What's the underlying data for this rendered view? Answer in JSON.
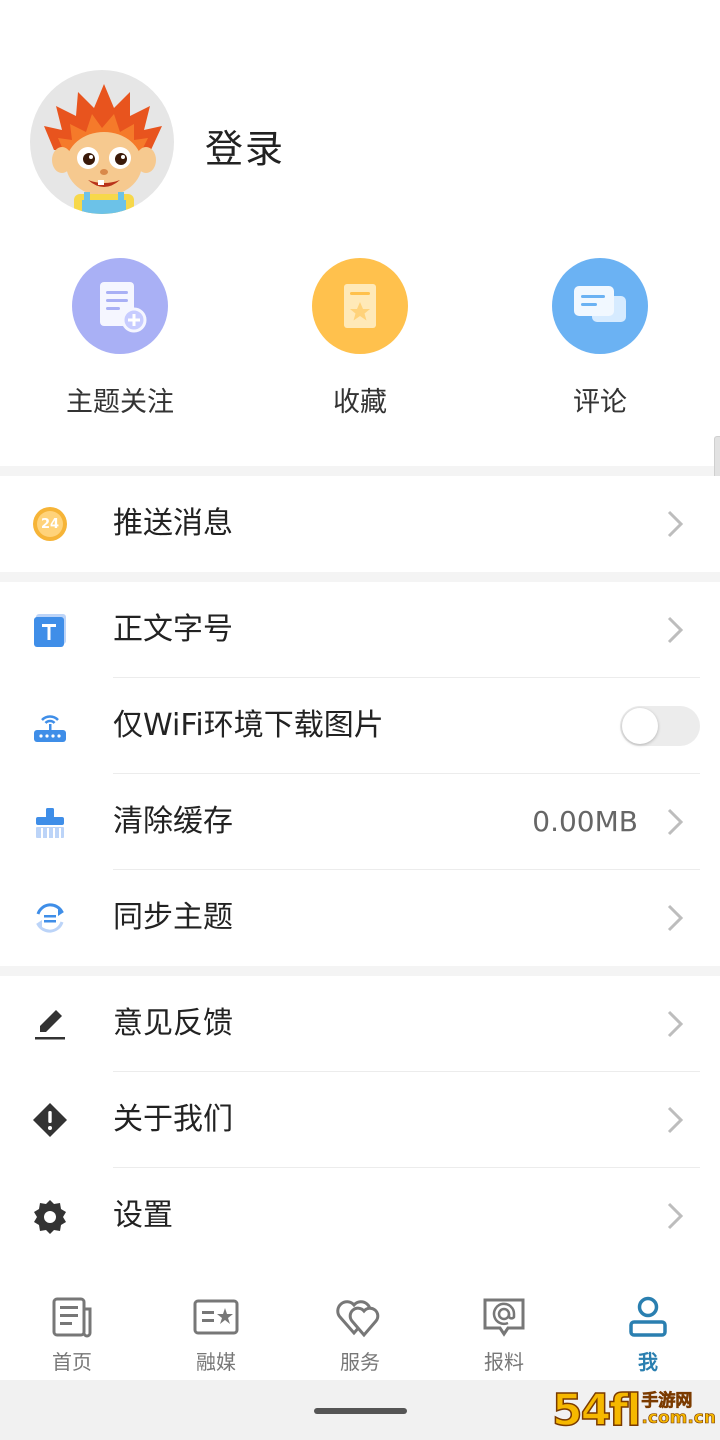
{
  "profile": {
    "login_label": "登录"
  },
  "quick_actions": [
    {
      "label": "主题关注",
      "icon": "document-add-icon",
      "color": "#a9b0f5"
    },
    {
      "label": "收藏",
      "icon": "bookmark-icon",
      "color": "#ffc14d"
    },
    {
      "label": "评论",
      "icon": "chat-bubbles-icon",
      "color": "#6bb2f3"
    }
  ],
  "menu": {
    "push": {
      "label": "推送消息",
      "badge": "24"
    },
    "font_size": {
      "label": "正文字号"
    },
    "wifi_images": {
      "label": "仅WiFi环境下载图片",
      "enabled": false
    },
    "clear_cache": {
      "label": "清除缓存",
      "value": "0.00MB"
    },
    "sync_theme": {
      "label": "同步主题"
    },
    "feedback": {
      "label": "意见反馈"
    },
    "about": {
      "label": "关于我们"
    },
    "settings": {
      "label": "设置"
    }
  },
  "tabs": [
    {
      "label": "首页",
      "icon": "newspaper-icon"
    },
    {
      "label": "融媒",
      "icon": "media-card-icon"
    },
    {
      "label": "服务",
      "icon": "hearts-icon"
    },
    {
      "label": "报料",
      "icon": "at-message-icon"
    },
    {
      "label": "我",
      "icon": "person-icon",
      "active": true
    }
  ],
  "watermark": {
    "big": "54fl",
    "small_top": "手游网",
    "small_bottom": ".com.cn"
  },
  "colors": {
    "accent": "#2a7fb0",
    "chevron": "#bdbdbd",
    "icon_dark": "#333333"
  }
}
